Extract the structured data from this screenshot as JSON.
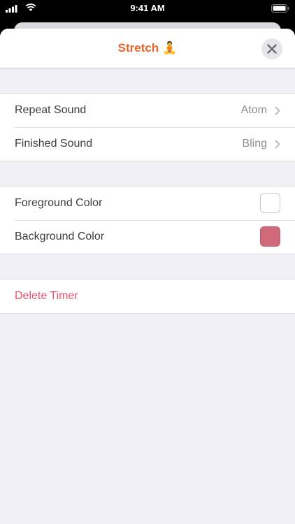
{
  "status_bar": {
    "time": "9:41 AM"
  },
  "header": {
    "title": "Stretch",
    "title_emoji": "🧘"
  },
  "sounds": [
    {
      "label": "Repeat Sound",
      "value": "Atom"
    },
    {
      "label": "Finished Sound",
      "value": "Bling"
    }
  ],
  "colors": [
    {
      "label": "Foreground Color",
      "swatch": "#ffffff"
    },
    {
      "label": "Background Color",
      "swatch": "#d06a7a"
    }
  ],
  "actions": {
    "delete_label": "Delete Timer"
  },
  "theme": {
    "title_color": "#e8642a",
    "delete_color": "#e3546c"
  }
}
